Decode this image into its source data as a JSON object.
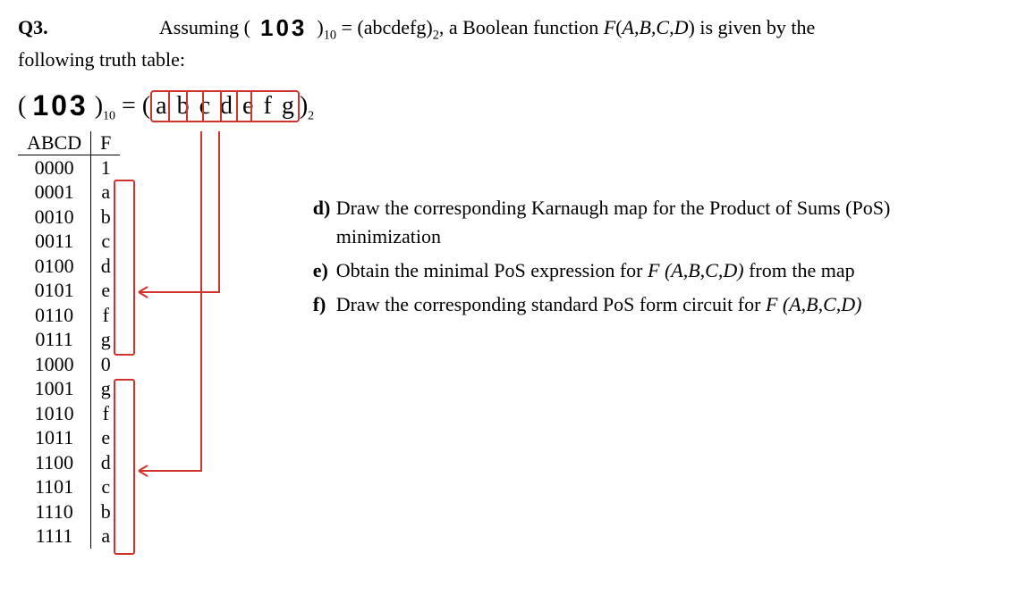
{
  "q_label": "Q3.",
  "line1_a": "Assuming ",
  "num_103": "103",
  "line1_b": " = (abcdefg)",
  "line1_c": ", a Boolean function ",
  "func_F": "F",
  "line1_d": "(",
  "vars": "A,B,C,D",
  "line1_e": ") is given by the",
  "following": "following truth table:",
  "disp_open": "( ",
  "disp_mid": " )",
  "disp_eq": " = ",
  "boxed": {
    "a": "a",
    "b": "b",
    "c": "c",
    "d": "d",
    "e": "e",
    "f": "f",
    "g": "g"
  },
  "table": {
    "h1": "ABCD",
    "h2": "F",
    "rows": [
      {
        "k": "0000",
        "v": "1"
      },
      {
        "k": "0001",
        "v": "a"
      },
      {
        "k": "0010",
        "v": "b"
      },
      {
        "k": "0011",
        "v": "c"
      },
      {
        "k": "0100",
        "v": "d"
      },
      {
        "k": "0101",
        "v": "e"
      },
      {
        "k": "0110",
        "v": "f"
      },
      {
        "k": "0111",
        "v": "g"
      },
      {
        "k": "1000",
        "v": "0"
      },
      {
        "k": "1001",
        "v": "g"
      },
      {
        "k": "1010",
        "v": "f"
      },
      {
        "k": "1011",
        "v": "e"
      },
      {
        "k": "1100",
        "v": "d"
      },
      {
        "k": "1101",
        "v": "c"
      },
      {
        "k": "1110",
        "v": "b"
      },
      {
        "k": "1111",
        "v": "a"
      }
    ]
  },
  "items": [
    {
      "bullet": "d)",
      "text_a": "Draw the corresponding Karnaugh map for the Product of Sums (PoS) minimization",
      "text_b": ""
    },
    {
      "bullet": "e)",
      "text_a": "Obtain the minimal PoS expression for ",
      "text_b": " from the map"
    },
    {
      "bullet": "f)",
      "text_a": "Draw the corresponding standard PoS form circuit for  ",
      "text_b": ""
    }
  ],
  "sub10": "10",
  "sub2": "2",
  "F_expr_open": "F (",
  "F_expr_close": ")"
}
